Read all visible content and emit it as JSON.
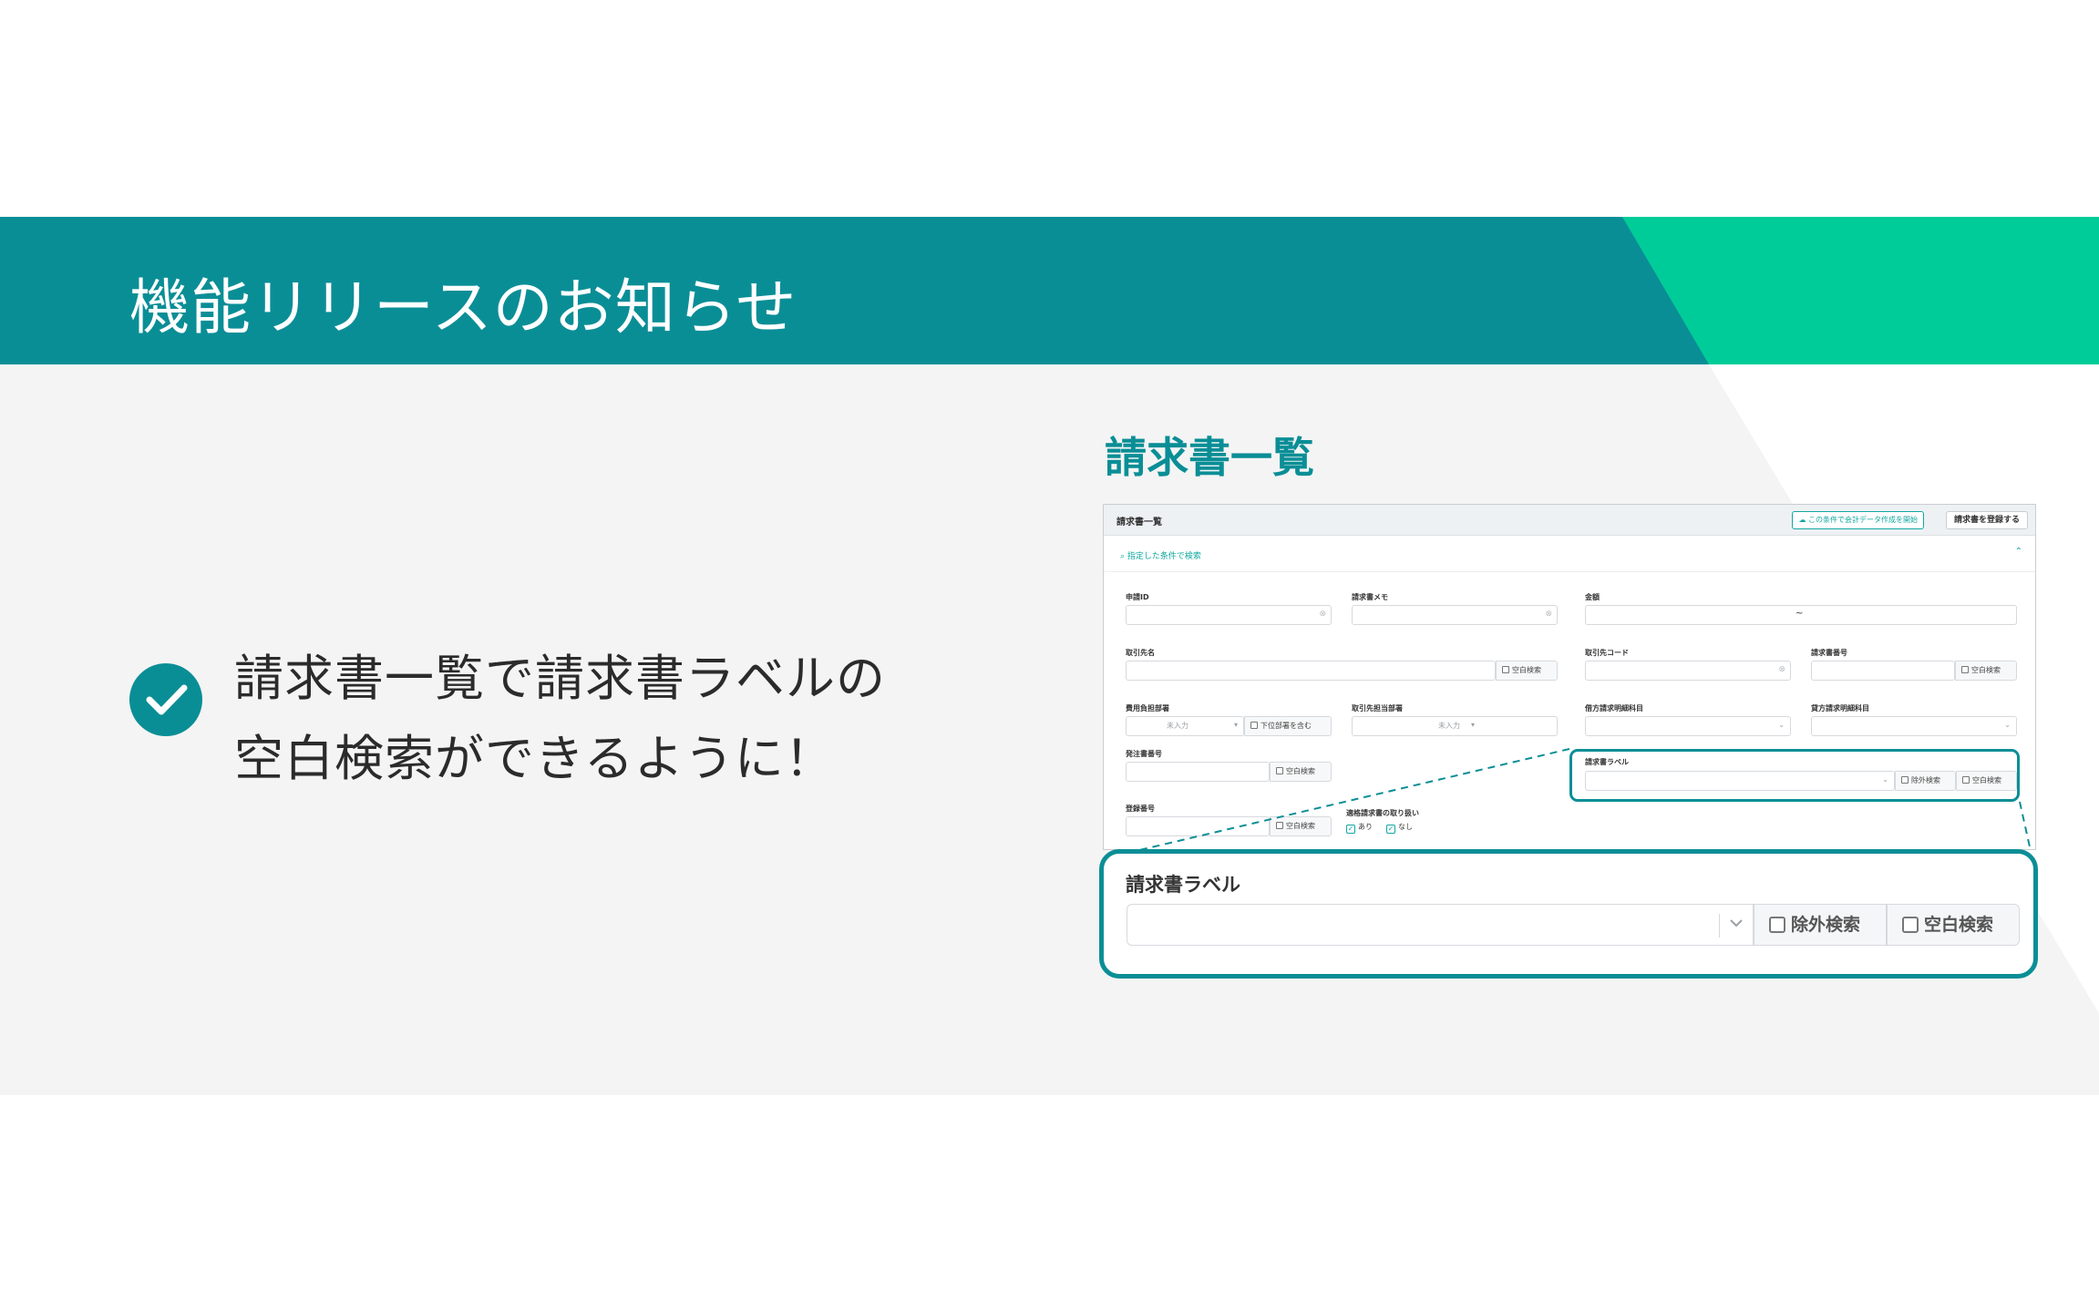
{
  "header": {
    "title": "機能リリースのお知らせ",
    "band_color": "#0a8e96",
    "accent_color": "#00cc99"
  },
  "message": {
    "line1": "請求書一覧で請求書ラベルの",
    "line2": "空白検索ができるように！",
    "icon": "check-circle-icon"
  },
  "screenshot": {
    "heading": "請求書一覧",
    "topbar_title": "請求書一覧",
    "export_button": "この条件で会計データ作成を開始",
    "register_button": "請求書を登録する",
    "filter_toggle": "指定した条件で検索",
    "fields": {
      "application_id": "申請ID",
      "memo": "請求書メモ",
      "amount": "金額",
      "amount_tilde": "~",
      "partner_name": "取引先名",
      "partner_code": "取引先コード",
      "invoice_number": "請求書番号",
      "cost_dept": "費用負担部署",
      "partner_dept": "取引先担当部署",
      "debit_account": "借方請求明細科目",
      "credit_account": "貸方請求明細科目",
      "po_number": "発注書番号",
      "invoice_label": "請求書ラベル",
      "registration_number": "登録番号",
      "qualified_invoice": "適格請求書の取り扱い"
    },
    "blank_search": "空白検索",
    "exclude_search": "除外検索",
    "include_sub_dept": "下位部署を含む",
    "unselected": "未入力",
    "option_yes": "あり",
    "option_no": "なし"
  },
  "zoom": {
    "label": "請求書ラベル",
    "exclude_search": "除外検索",
    "blank_search": "空白検索"
  }
}
